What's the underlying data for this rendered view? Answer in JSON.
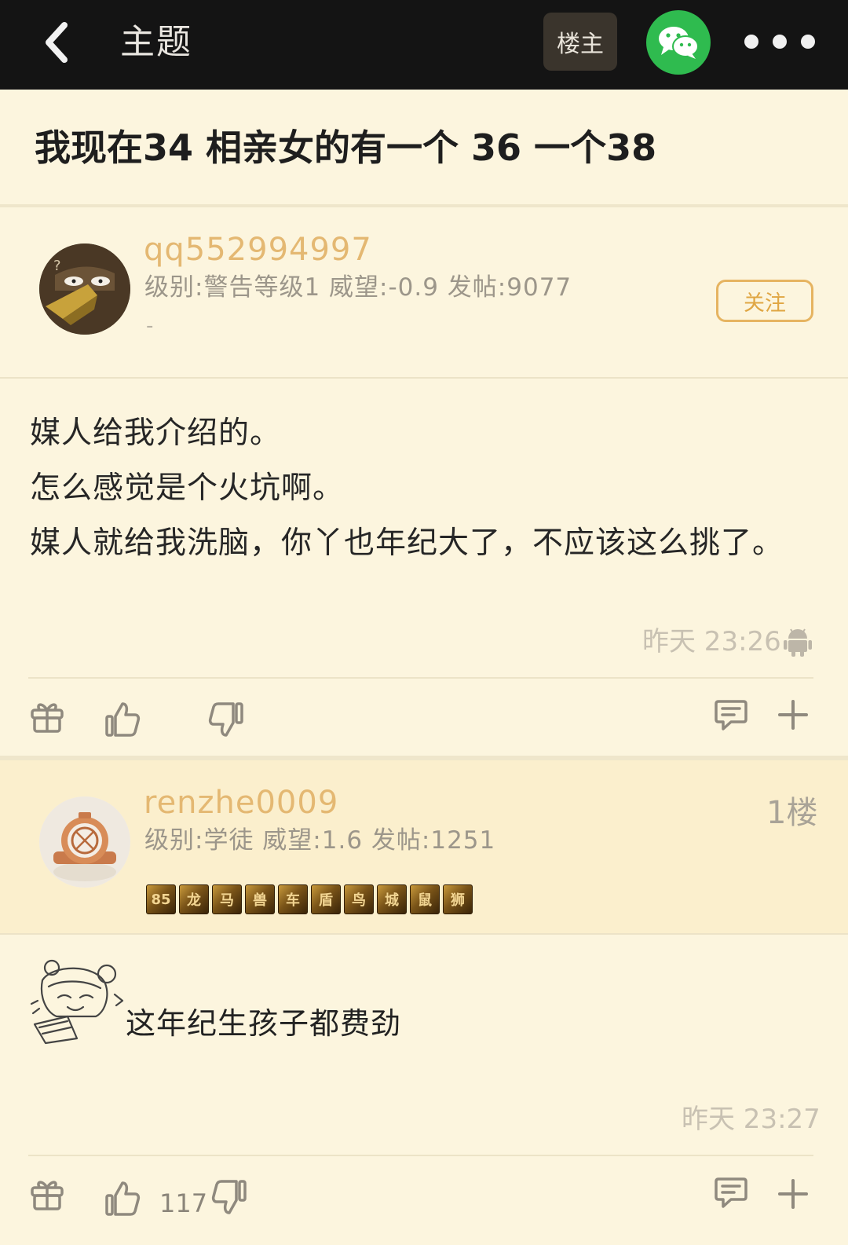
{
  "topbar": {
    "title": "主题",
    "op_label": "楼主",
    "colors": {
      "bg": "#141414",
      "wechat": "#2fbb4f"
    }
  },
  "thread": {
    "title": "我现在34 相亲女的有一个 36 一个38"
  },
  "op_post": {
    "username": "qq552994997",
    "meta": "级别:警告等级1 威望:-0.9 发帖:9077",
    "signature": "-",
    "follow_label": "关注",
    "body": [
      "媒人给我介绍的。",
      "怎么感觉是个火坑啊。",
      "媒人就给我洗脑，你丫也年纪大了，不应该这么挑了。"
    ],
    "time": "昨天 23:26",
    "device_icon": "android-icon"
  },
  "reply_1": {
    "username": "renzhe0009",
    "meta": "级别:学徒 威望:1.6 发帖:1251",
    "floor": "1楼",
    "badges": [
      "85",
      "龙",
      "马",
      "兽",
      "车",
      "盾",
      "鸟",
      "城",
      "鼠",
      "狮"
    ],
    "text": "这年纪生孩子都费劲",
    "time": "昨天 23:27",
    "like_count": "117"
  },
  "colors": {
    "username": "#e4b872",
    "follow": "#e0a643",
    "page_bg": "#fcf5de",
    "floor_bg": "#fbefcd"
  }
}
